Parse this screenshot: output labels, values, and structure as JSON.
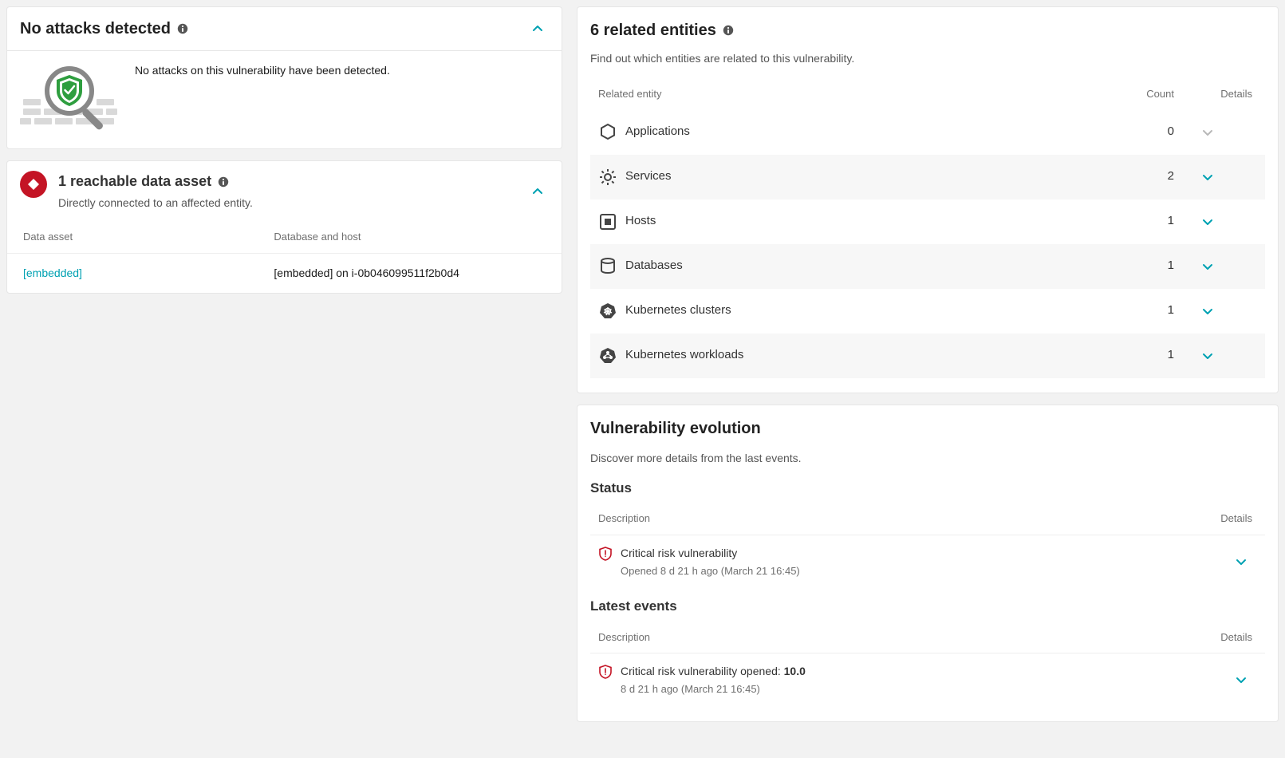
{
  "attacks": {
    "title": "No attacks detected",
    "body": "No attacks on this vulnerability have been detected."
  },
  "reachable": {
    "title": "1 reachable data asset",
    "subtitle": "Directly connected to an affected entity.",
    "columns": {
      "asset": "Data asset",
      "dbhost": "Database and host"
    },
    "row": {
      "asset": "[embedded]",
      "dbhost": "[embedded] on i-0b046099511f2b0d4"
    }
  },
  "related": {
    "title": "6 related entities",
    "desc": "Find out which entities are related to this vulnerability.",
    "columns": {
      "entity": "Related entity",
      "count": "Count",
      "details": "Details"
    },
    "items": [
      {
        "label": "Applications",
        "count": "0"
      },
      {
        "label": "Services",
        "count": "2"
      },
      {
        "label": "Hosts",
        "count": "1"
      },
      {
        "label": "Databases",
        "count": "1"
      },
      {
        "label": "Kubernetes clusters",
        "count": "1"
      },
      {
        "label": "Kubernetes workloads",
        "count": "1"
      }
    ]
  },
  "evolution": {
    "title": "Vulnerability evolution",
    "desc": "Discover more details from the last events.",
    "status": {
      "section_label": "Status",
      "columns": {
        "desc": "Description",
        "details": "Details"
      },
      "item": {
        "title": "Critical risk vulnerability",
        "sub": "Opened 8 d 21 h ago (March 21 16:45)"
      }
    },
    "latest": {
      "section_label": "Latest events",
      "columns": {
        "desc": "Description",
        "details": "Details"
      },
      "item": {
        "title_prefix": "Critical risk vulnerability opened: ",
        "title_bold": "10.0",
        "sub": "8 d 21 h ago (March 21 16:45)"
      }
    }
  }
}
